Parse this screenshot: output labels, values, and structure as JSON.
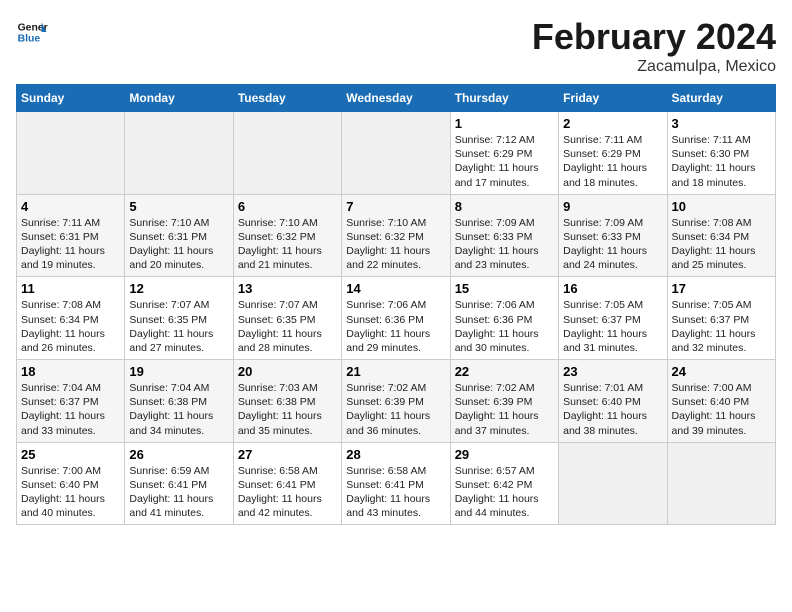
{
  "header": {
    "logo_line1": "General",
    "logo_line2": "Blue",
    "month": "February 2024",
    "location": "Zacamulpa, Mexico"
  },
  "days_of_week": [
    "Sunday",
    "Monday",
    "Tuesday",
    "Wednesday",
    "Thursday",
    "Friday",
    "Saturday"
  ],
  "weeks": [
    [
      {
        "day": "",
        "empty": true
      },
      {
        "day": "",
        "empty": true
      },
      {
        "day": "",
        "empty": true
      },
      {
        "day": "",
        "empty": true
      },
      {
        "day": "1",
        "sunrise": "7:12 AM",
        "sunset": "6:29 PM",
        "daylight": "11 hours and 17 minutes."
      },
      {
        "day": "2",
        "sunrise": "7:11 AM",
        "sunset": "6:29 PM",
        "daylight": "11 hours and 18 minutes."
      },
      {
        "day": "3",
        "sunrise": "7:11 AM",
        "sunset": "6:30 PM",
        "daylight": "11 hours and 18 minutes."
      }
    ],
    [
      {
        "day": "4",
        "sunrise": "7:11 AM",
        "sunset": "6:31 PM",
        "daylight": "11 hours and 19 minutes."
      },
      {
        "day": "5",
        "sunrise": "7:10 AM",
        "sunset": "6:31 PM",
        "daylight": "11 hours and 20 minutes."
      },
      {
        "day": "6",
        "sunrise": "7:10 AM",
        "sunset": "6:32 PM",
        "daylight": "11 hours and 21 minutes."
      },
      {
        "day": "7",
        "sunrise": "7:10 AM",
        "sunset": "6:32 PM",
        "daylight": "11 hours and 22 minutes."
      },
      {
        "day": "8",
        "sunrise": "7:09 AM",
        "sunset": "6:33 PM",
        "daylight": "11 hours and 23 minutes."
      },
      {
        "day": "9",
        "sunrise": "7:09 AM",
        "sunset": "6:33 PM",
        "daylight": "11 hours and 24 minutes."
      },
      {
        "day": "10",
        "sunrise": "7:08 AM",
        "sunset": "6:34 PM",
        "daylight": "11 hours and 25 minutes."
      }
    ],
    [
      {
        "day": "11",
        "sunrise": "7:08 AM",
        "sunset": "6:34 PM",
        "daylight": "11 hours and 26 minutes."
      },
      {
        "day": "12",
        "sunrise": "7:07 AM",
        "sunset": "6:35 PM",
        "daylight": "11 hours and 27 minutes."
      },
      {
        "day": "13",
        "sunrise": "7:07 AM",
        "sunset": "6:35 PM",
        "daylight": "11 hours and 28 minutes."
      },
      {
        "day": "14",
        "sunrise": "7:06 AM",
        "sunset": "6:36 PM",
        "daylight": "11 hours and 29 minutes."
      },
      {
        "day": "15",
        "sunrise": "7:06 AM",
        "sunset": "6:36 PM",
        "daylight": "11 hours and 30 minutes."
      },
      {
        "day": "16",
        "sunrise": "7:05 AM",
        "sunset": "6:37 PM",
        "daylight": "11 hours and 31 minutes."
      },
      {
        "day": "17",
        "sunrise": "7:05 AM",
        "sunset": "6:37 PM",
        "daylight": "11 hours and 32 minutes."
      }
    ],
    [
      {
        "day": "18",
        "sunrise": "7:04 AM",
        "sunset": "6:37 PM",
        "daylight": "11 hours and 33 minutes."
      },
      {
        "day": "19",
        "sunrise": "7:04 AM",
        "sunset": "6:38 PM",
        "daylight": "11 hours and 34 minutes."
      },
      {
        "day": "20",
        "sunrise": "7:03 AM",
        "sunset": "6:38 PM",
        "daylight": "11 hours and 35 minutes."
      },
      {
        "day": "21",
        "sunrise": "7:02 AM",
        "sunset": "6:39 PM",
        "daylight": "11 hours and 36 minutes."
      },
      {
        "day": "22",
        "sunrise": "7:02 AM",
        "sunset": "6:39 PM",
        "daylight": "11 hours and 37 minutes."
      },
      {
        "day": "23",
        "sunrise": "7:01 AM",
        "sunset": "6:40 PM",
        "daylight": "11 hours and 38 minutes."
      },
      {
        "day": "24",
        "sunrise": "7:00 AM",
        "sunset": "6:40 PM",
        "daylight": "11 hours and 39 minutes."
      }
    ],
    [
      {
        "day": "25",
        "sunrise": "7:00 AM",
        "sunset": "6:40 PM",
        "daylight": "11 hours and 40 minutes."
      },
      {
        "day": "26",
        "sunrise": "6:59 AM",
        "sunset": "6:41 PM",
        "daylight": "11 hours and 41 minutes."
      },
      {
        "day": "27",
        "sunrise": "6:58 AM",
        "sunset": "6:41 PM",
        "daylight": "11 hours and 42 minutes."
      },
      {
        "day": "28",
        "sunrise": "6:58 AM",
        "sunset": "6:41 PM",
        "daylight": "11 hours and 43 minutes."
      },
      {
        "day": "29",
        "sunrise": "6:57 AM",
        "sunset": "6:42 PM",
        "daylight": "11 hours and 44 minutes."
      },
      {
        "day": "",
        "empty": true
      },
      {
        "day": "",
        "empty": true
      }
    ]
  ]
}
